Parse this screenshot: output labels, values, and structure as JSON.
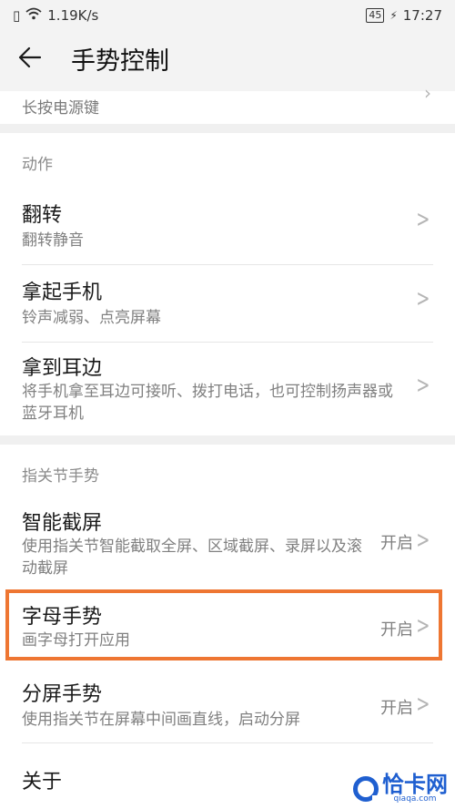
{
  "status_bar": {
    "network_speed": "1.19K/s",
    "battery": "45",
    "time": "17:27"
  },
  "header": {
    "title": "手势控制"
  },
  "partial_item": {
    "subtitle": "长按电源键"
  },
  "sections": {
    "actions": {
      "label": "动作",
      "items": [
        {
          "title": "翻转",
          "subtitle": "翻转静音"
        },
        {
          "title": "拿起手机",
          "subtitle": "铃声减弱、点亮屏幕"
        },
        {
          "title": "拿到耳边",
          "subtitle": "将手机拿至耳边可接听、拨打电话，也可控制扬声器或蓝牙耳机"
        }
      ]
    },
    "knuckle": {
      "label": "指关节手势",
      "items": [
        {
          "title": "智能截屏",
          "subtitle": "使用指关节智能截取全屏、区域截屏、录屏以及滚动截屏",
          "value": "开启"
        },
        {
          "title": "字母手势",
          "subtitle": "画字母打开应用",
          "value": "开启"
        },
        {
          "title": "分屏手势",
          "subtitle": "使用指关节在屏幕中间画直线，启动分屏",
          "value": "开启"
        }
      ]
    }
  },
  "about": {
    "title": "关于"
  },
  "watermark": {
    "brand": "恰卡网",
    "url": "qiaqa.com"
  },
  "colors": {
    "highlight": "#ee7632",
    "watermark": "#1f5fd0"
  }
}
